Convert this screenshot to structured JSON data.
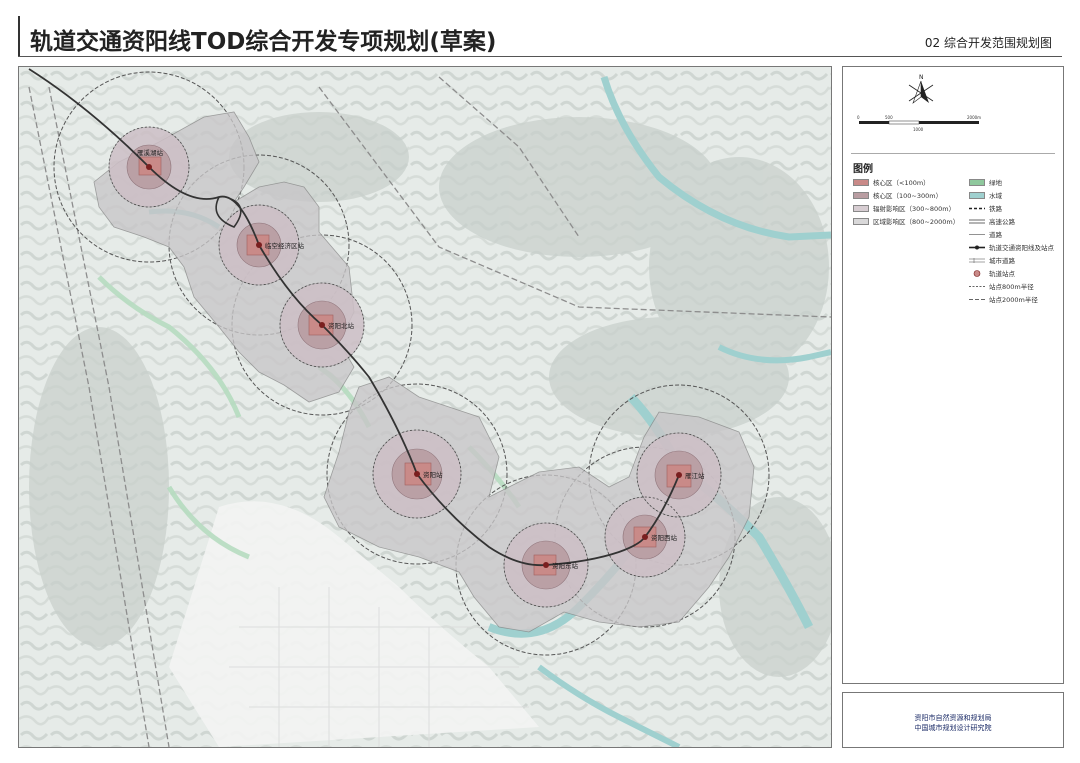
{
  "header": {
    "title": "轨道交通资阳线TOD综合开发专项规划(草案)",
    "sheet_title": "02  综合开发范围规划图"
  },
  "map": {
    "stations": [
      {
        "label": "雁溪湖站"
      },
      {
        "label": "临空经济区站"
      },
      {
        "label": "资阳北站"
      },
      {
        "label": "资阳站"
      },
      {
        "label": "资阳东站"
      },
      {
        "label": "资阳西站"
      },
      {
        "label": "雁江站"
      }
    ],
    "colors": {
      "core_zone": "#c98a88",
      "core_fill": "#d9a4a4",
      "inner_zone": "#b99da2",
      "radiation_zone": "#cdbfc6",
      "influence_zone": "#c8c6c8",
      "water": "#9fd0cf",
      "green": "#8fc89d",
      "rail_line": "#333333"
    }
  },
  "legend": {
    "north_label": "N",
    "scale_labels": [
      "0",
      "500",
      "1000",
      "2000m"
    ],
    "title": "图例",
    "items_left": [
      {
        "label": "核心区（<100m）",
        "color": "#c98a88"
      },
      {
        "label": "核心区（100~300m）",
        "color": "#b99da2"
      },
      {
        "label": "辐射影响区（300~800m）",
        "color": "#d7cdd2"
      },
      {
        "label": "区域影响区（800~2000m）",
        "color": "#d9d8d9"
      }
    ],
    "items_right": [
      {
        "label": "绿地",
        "type": "green"
      },
      {
        "label": "水域",
        "type": "water"
      },
      {
        "label": "铁路",
        "type": "rail"
      },
      {
        "label": "高速公路",
        "type": "highway"
      },
      {
        "label": "道路",
        "type": "road"
      },
      {
        "label": "轨道交通资阳线及站点",
        "type": "metro"
      },
      {
        "label": "城市道路",
        "type": "city-road"
      },
      {
        "label": "轨道站点",
        "type": "station"
      },
      {
        "label": "站点800m半径",
        "type": "r800"
      },
      {
        "label": "站点2000m半径",
        "type": "r2000"
      }
    ]
  },
  "credits": {
    "line1": "资阳市自然资源和规划局",
    "line2": "中国城市规划设计研究院"
  }
}
